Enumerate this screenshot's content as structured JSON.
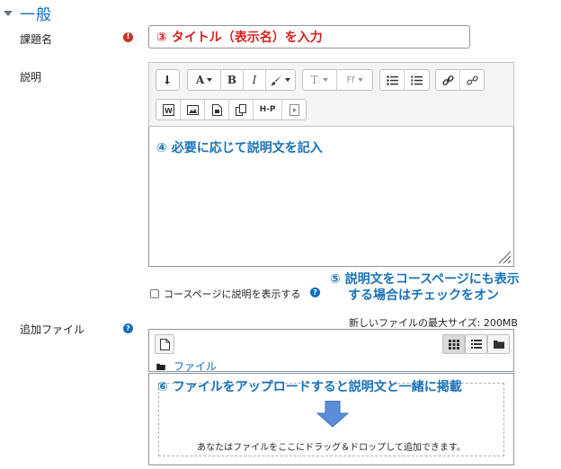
{
  "section": {
    "title": "一般"
  },
  "name_field": {
    "label": "課題名",
    "value": "③ タイトル（表示名）を入力"
  },
  "description_field": {
    "label": "説明",
    "annotation": "④ 必要に応じて説明文を記入"
  },
  "toolbar": {
    "row1": [
      "undo",
      "font-size",
      "bold",
      "italic",
      "brush",
      "text-style",
      "font-family",
      "bullet-list",
      "numbered-list",
      "link",
      "unlink"
    ],
    "row2": [
      "word-import",
      "image",
      "media",
      "manage-files",
      "h5p",
      "record-video"
    ],
    "labels": {
      "bold": "B",
      "italic": "I",
      "h5p": "H-P",
      "font_a": "A",
      "text_style": "T",
      "font_family": "Ff"
    }
  },
  "show_description": {
    "label": "コースページに説明を表示する",
    "annotation_line1": "⑤ 説明文をコースページにも表示",
    "annotation_line2": "する場合はチェックをオン"
  },
  "attachments": {
    "label": "追加ファイル",
    "max_size": "新しいファイルの最大サイズ: 200MB",
    "folder_link": "ファイル",
    "annotation": "⑥ ファイルをアップロードすると説明文と一緒に掲載",
    "drop_hint": "あなたはファイルをここにドラッグ＆ドロップして追加できます。"
  },
  "colors": {
    "primary": "#0f6cbf",
    "required": "#ca3120",
    "annotation_red": "#d82020",
    "annotation_blue": "#1a73b8",
    "arrow": "#5b8dd9"
  },
  "icons": [
    "caret-down-icon",
    "required-icon",
    "help-icon",
    "grid-view-icon",
    "list-view-icon",
    "folder-icon",
    "file-icon",
    "down-arrow-icon"
  ]
}
